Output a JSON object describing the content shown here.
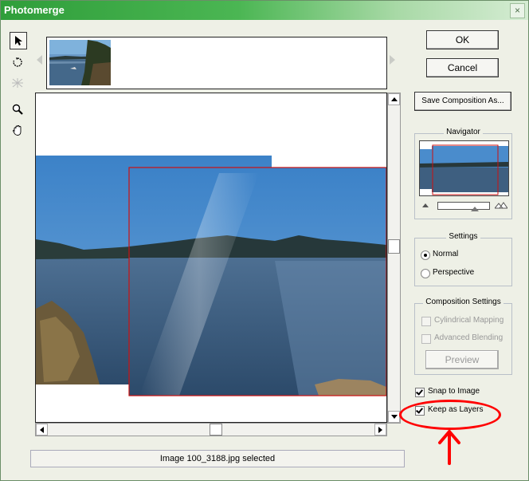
{
  "window": {
    "title": "Photomerge"
  },
  "tools": [
    "select-image-tool",
    "rotate-image-tool",
    "set-vanishing-point-tool",
    "zoom-tool",
    "hand-tool"
  ],
  "buttons": {
    "ok": "OK",
    "cancel": "Cancel",
    "save_composition": "Save Composition As...",
    "preview": "Preview"
  },
  "navigator": {
    "title": "Navigator"
  },
  "settings": {
    "title": "Settings",
    "options": [
      {
        "label": "Normal",
        "selected": true
      },
      {
        "label": "Perspective",
        "selected": false
      }
    ]
  },
  "composition_settings": {
    "title": "Composition Settings",
    "cylindrical_mapping": {
      "label": "Cylindrical Mapping",
      "checked": false,
      "enabled": false
    },
    "advanced_blending": {
      "label": "Advanced Blending",
      "checked": false,
      "enabled": false
    }
  },
  "options": {
    "snap_to_image": {
      "label": "Snap to Image",
      "checked": true
    },
    "keep_as_layers": {
      "label": "Keep as Layers",
      "checked": true
    }
  },
  "status": {
    "text": "Image 100_3188.jpg selected"
  },
  "colors": {
    "annotation": "#ff0000",
    "title_bar": "#3aa845",
    "selection_border": "#cc1111"
  }
}
